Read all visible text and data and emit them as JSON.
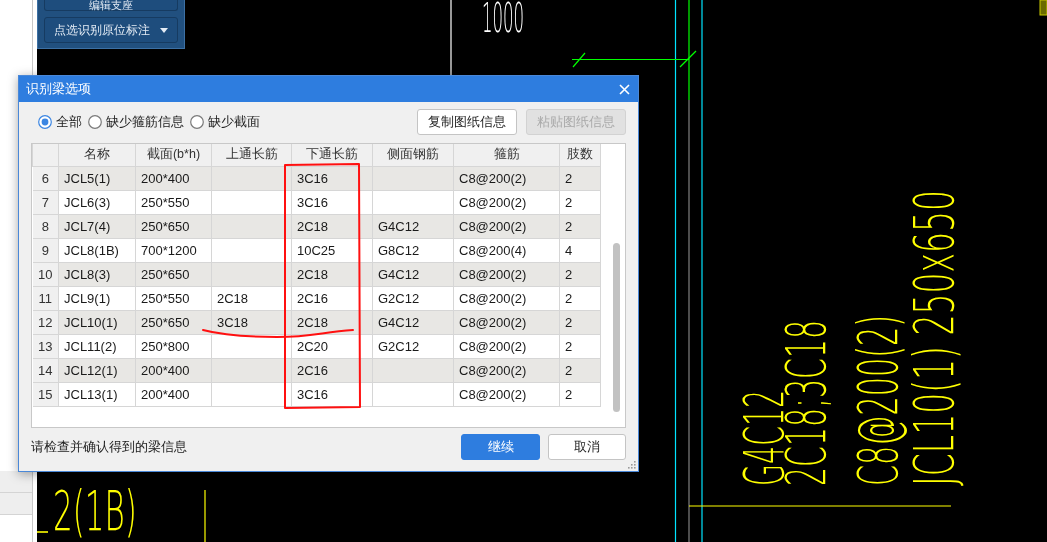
{
  "tool_panel": {
    "buttons": [
      {
        "label": "编辑支座",
        "kind": "plain"
      },
      {
        "label": "点选识别原位标注",
        "kind": "dropdown"
      }
    ]
  },
  "drawing": {
    "dimension": "1000",
    "beam_label": "2(1B)",
    "annotations": [
      "G4C12",
      "2C18;3C18",
      "C8@200(2)",
      "JCL10(1) 250x650"
    ]
  },
  "dialog": {
    "title": "识别梁选项",
    "filters": [
      {
        "label": "全部",
        "selected": true
      },
      {
        "label": "缺少箍筋信息",
        "selected": false
      },
      {
        "label": "缺少截面",
        "selected": false
      }
    ],
    "actions": [
      {
        "label": "复制图纸信息",
        "disabled": false
      },
      {
        "label": "粘贴图纸信息",
        "disabled": true
      }
    ],
    "table": {
      "columns": [
        "名称",
        "截面(b*h)",
        "上通长筋",
        "下通长筋",
        "侧面钢筋",
        "箍筋",
        "肢数"
      ],
      "rows": [
        {
          "number": "6",
          "name": "JCL5(1)",
          "section": "200*400",
          "bottom_bar": "3C16",
          "stirrup": "C8@200(2)",
          "legs": "2"
        },
        {
          "number": "7",
          "name": "JCL6(3)",
          "section": "250*550",
          "bottom_bar": "3C16",
          "stirrup": "C8@200(2)",
          "legs": "2"
        },
        {
          "number": "8",
          "name": "JCL7(4)",
          "section": "250*650",
          "bottom_bar": "2C18",
          "side_bar": "G4C12",
          "stirrup": "C8@200(2)",
          "legs": "2"
        },
        {
          "number": "9",
          "name": "JCL8(1B)",
          "section": "700*1200",
          "bottom_bar": "10C25",
          "side_bar": "G8C12",
          "stirrup": "C8@200(4)",
          "legs": "4"
        },
        {
          "number": "10",
          "name": "JCL8(3)",
          "section": "250*650",
          "bottom_bar": "2C18",
          "side_bar": "G4C12",
          "stirrup": "C8@200(2)",
          "legs": "2"
        },
        {
          "number": "11",
          "name": "JCL9(1)",
          "section": "250*550",
          "top_bar": "2C18",
          "bottom_bar": "2C16",
          "side_bar": "G2C12",
          "stirrup": "C8@200(2)",
          "legs": "2"
        },
        {
          "number": "12",
          "name": "JCL10(1)",
          "section": "250*650",
          "top_bar": "3C18",
          "bottom_bar": "2C18",
          "side_bar": "G4C12",
          "stirrup": "C8@200(2)",
          "legs": "2"
        },
        {
          "number": "13",
          "name": "JCL11(2)",
          "section": "250*800",
          "bottom_bar": "2C20",
          "side_bar": "G2C12",
          "stirrup": "C8@200(2)",
          "legs": "2"
        },
        {
          "number": "14",
          "name": "JCL12(1)",
          "section": "200*400",
          "bottom_bar": "2C16",
          "stirrup": "C8@200(2)",
          "legs": "2"
        },
        {
          "number": "15",
          "name": "JCL13(1)",
          "section": "200*400",
          "bottom_bar": "3C16",
          "stirrup": "C8@200(2)",
          "legs": "2"
        }
      ]
    },
    "status": "请检查并确认得到的梁信息",
    "buttons": [
      {
        "label": "继续",
        "kind": "primary"
      },
      {
        "label": "取消",
        "kind": "secondary"
      }
    ]
  }
}
